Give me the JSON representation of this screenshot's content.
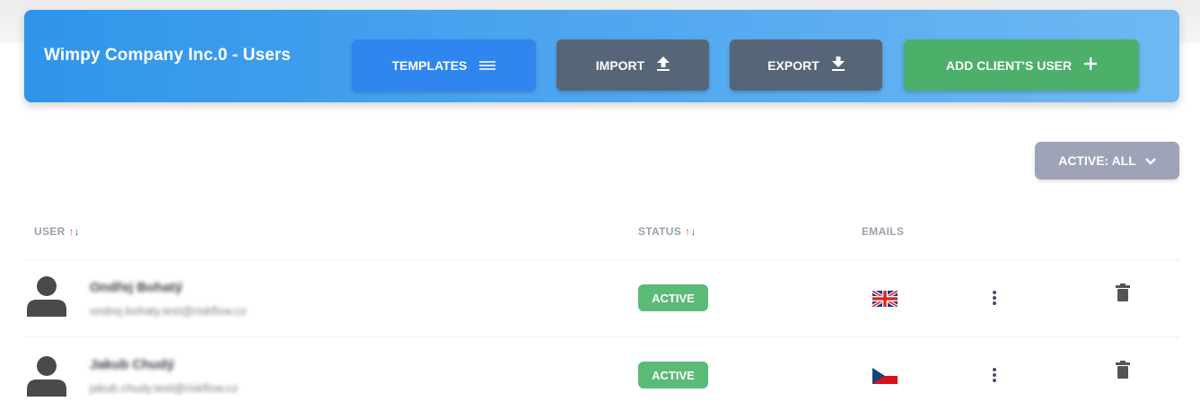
{
  "header": {
    "title": "Wimpy Company Inc.0 - Users",
    "buttons": {
      "templates": {
        "label": "TEMPLATES",
        "icon": "list-icon"
      },
      "import": {
        "label": "IMPORT",
        "icon": "upload-icon"
      },
      "export": {
        "label": "EXPORT",
        "icon": "download-icon"
      },
      "add": {
        "label": "ADD CLIENT'S USER",
        "icon": "plus-icon"
      }
    }
  },
  "filter": {
    "label": "ACTIVE: ALL",
    "icon": "chevron-down-icon"
  },
  "table": {
    "columns": {
      "user": "USER",
      "status": "STATUS",
      "emails": "EMAILS",
      "sort_up": "↑",
      "sort_down": "↓"
    },
    "rows": [
      {
        "name": "Ondřej Bohatý",
        "email": "ondrej.bohaty.test@riskflow.cz",
        "status": "ACTIVE",
        "email_lang": "uk-flag-icon"
      },
      {
        "name": "Jakub Chudý",
        "email": "jakub.chudy.test@riskflow.cz",
        "status": "ACTIVE",
        "email_lang": "czech-flag-icon"
      }
    ]
  },
  "colors": {
    "header_gradient_start": "#2f95ea",
    "templates_button": "#2f86ef",
    "import_export_button": "#566678",
    "add_button": "#4caf6a",
    "active_badge": "#5cba77",
    "filter_button": "#9ea3b8"
  }
}
